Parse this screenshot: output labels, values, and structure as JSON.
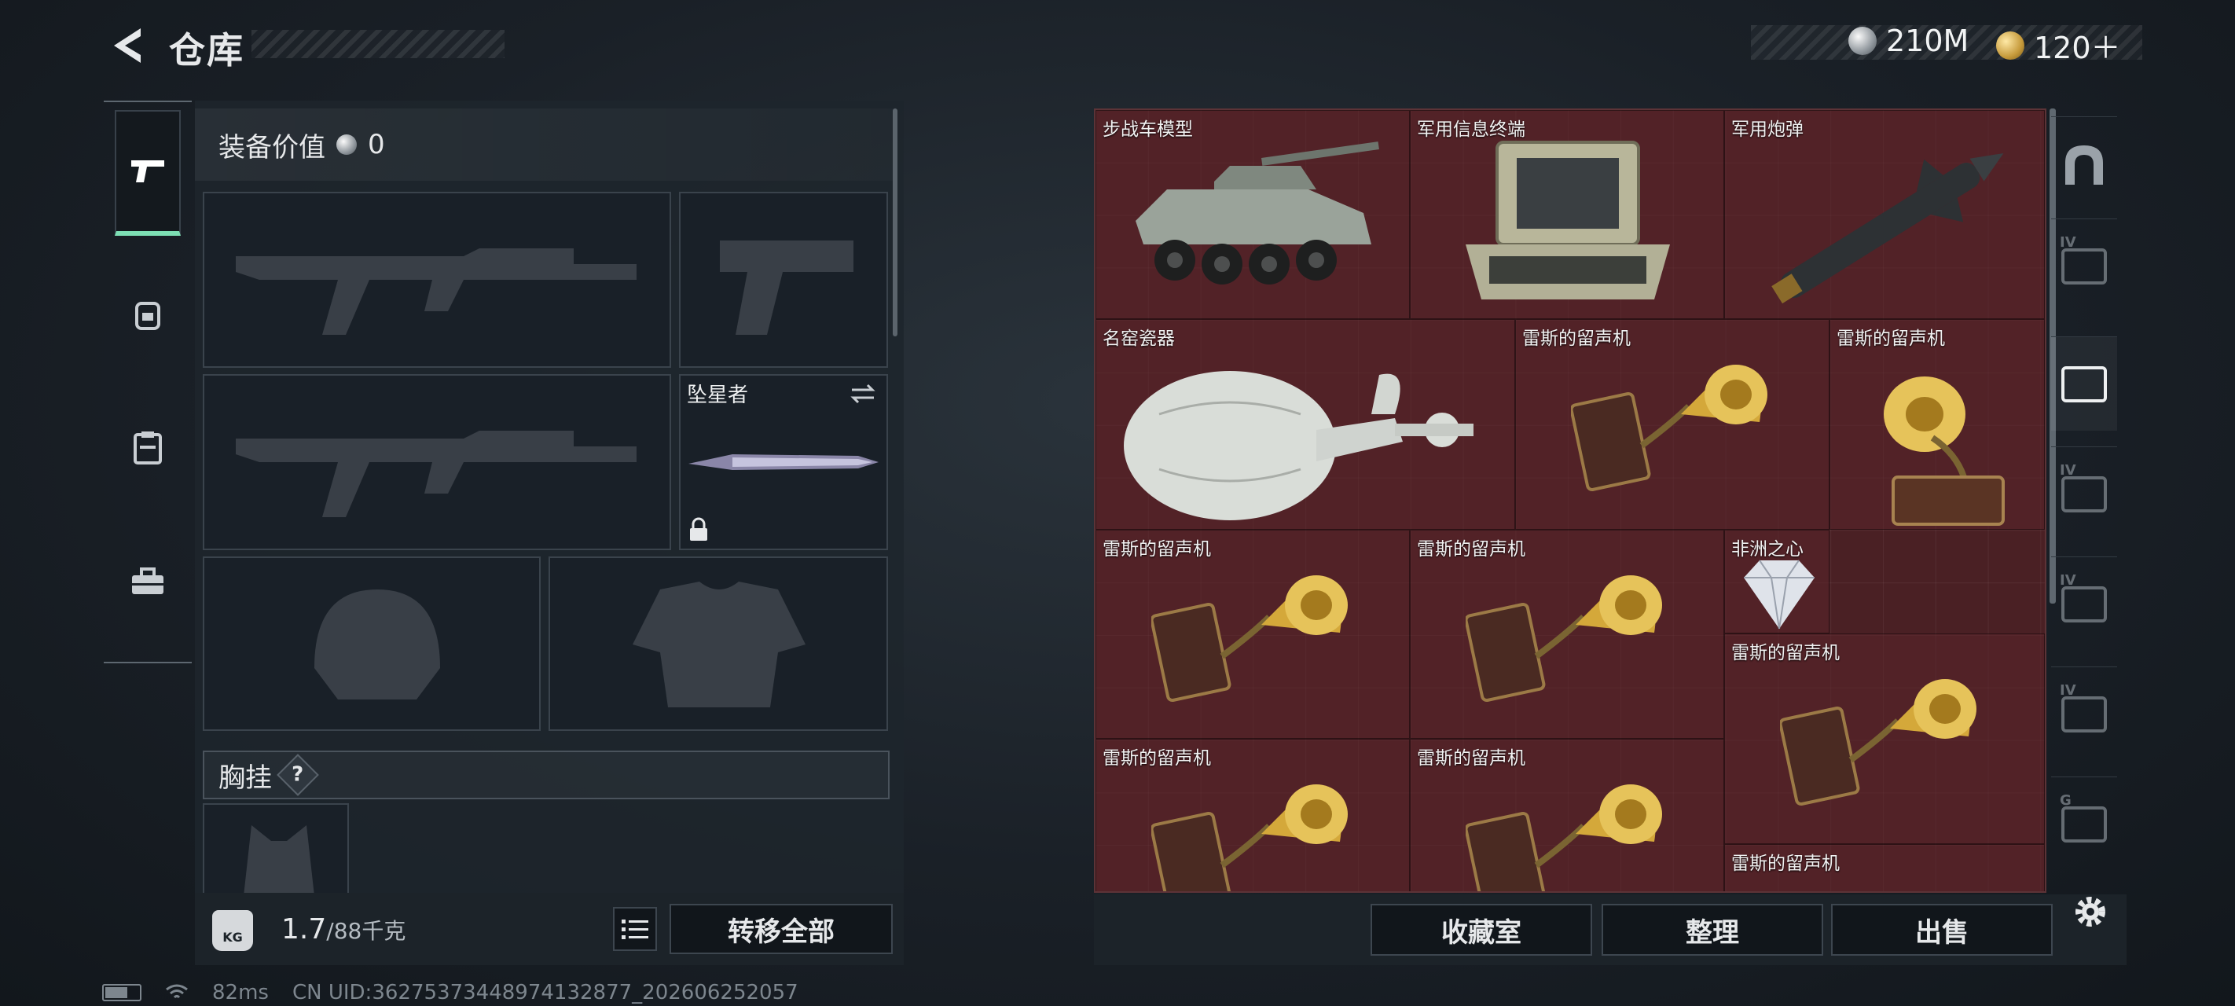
{
  "header": {
    "title": "仓库",
    "currency_silver": "210M",
    "currency_gold": "120＋"
  },
  "left_tabs": [
    {
      "icon": "pistol-icon",
      "active": true
    },
    {
      "icon": "backpack-icon",
      "active": false
    },
    {
      "icon": "clipboard-icon",
      "active": false
    },
    {
      "icon": "toolbox-icon",
      "active": false
    }
  ],
  "equipment": {
    "value_label": "装备价值",
    "value": "0",
    "melee_slot_label": "坠星者",
    "chest_rig_label": "胸挂",
    "chest_rig_help": "?",
    "weight": "1.7",
    "weight_max": "/88千克",
    "kg_badge": "KG",
    "transfer_all": "转移全部"
  },
  "warehouse_items": [
    {
      "label": "步战车模型",
      "icon": "ifv-model-icon"
    },
    {
      "label": "军用信息终端",
      "icon": "military-terminal-icon"
    },
    {
      "label": "军用炮弹",
      "icon": "artillery-shell-icon"
    },
    {
      "label": "名窑瓷器",
      "icon": "porcelain-vase-icon"
    },
    {
      "label": "雷斯的留声机",
      "icon": "gramophone-icon"
    },
    {
      "label": "雷斯的留声机",
      "icon": "gramophone-icon"
    },
    {
      "label": "雷斯的留声机",
      "icon": "gramophone-icon"
    },
    {
      "label": "雷斯的留声机",
      "icon": "gramophone-icon"
    },
    {
      "label": "非洲之心",
      "icon": "diamond-icon"
    },
    {
      "label": "雷斯的留声机",
      "icon": "gramophone-icon"
    },
    {
      "label": "雷斯的留声机",
      "icon": "gramophone-icon"
    },
    {
      "label": "雷斯的留声机",
      "icon": "gramophone-icon"
    },
    {
      "label": "雷斯的留声机",
      "icon": "gramophone-icon"
    }
  ],
  "right_tabs": [
    {
      "icon": "arch-icon",
      "tag": ""
    },
    {
      "icon": "storage-iv-icon",
      "tag": "IV"
    },
    {
      "icon": "camera-storage-icon",
      "tag": ""
    },
    {
      "icon": "storage-iv-icon",
      "tag": "IV"
    },
    {
      "icon": "storage-iv-icon",
      "tag": "IV"
    },
    {
      "icon": "storage-iv-icon",
      "tag": "IV"
    },
    {
      "icon": "storage-g-icon",
      "tag": "G"
    }
  ],
  "bottom_buttons": {
    "collection": "收藏室",
    "organize": "整理",
    "sell": "出售"
  },
  "status": {
    "ping": "82ms",
    "uid": "CN UID:36275373448974132877_202606252057"
  },
  "colors": {
    "accent_green": "#7ddfb4",
    "grid_bg": "#4a2024"
  }
}
